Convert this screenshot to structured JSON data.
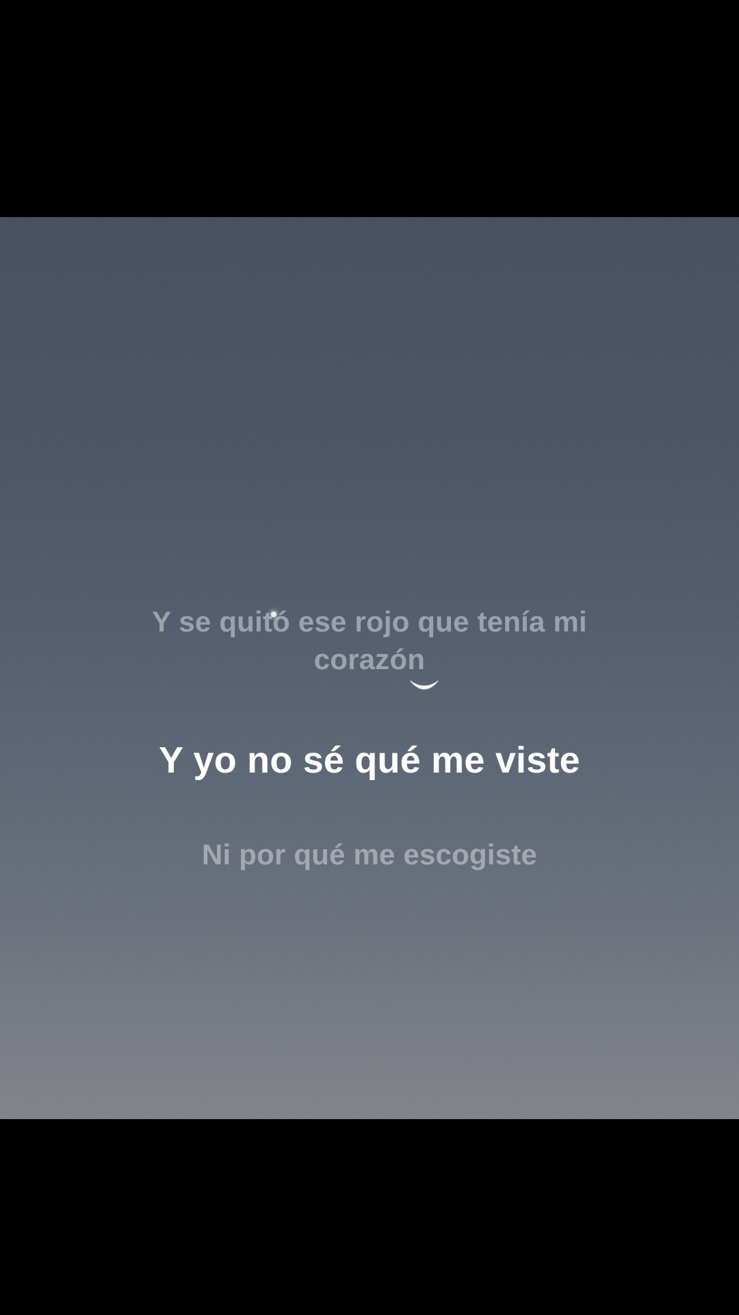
{
  "lyrics": {
    "previous_line_1": "Y se quitó ese rojo que tenía mi",
    "previous_line_2": "corazón",
    "current_line": "Y yo no sé qué me viste",
    "next_line": "Ni por qué me escogiste"
  },
  "icons": {
    "moon": "crescent-moon-icon",
    "star": "star-icon"
  },
  "colors": {
    "background": "#000000",
    "sky_top": "#3c4757",
    "sky_bottom": "#7c7f86",
    "current_lyric": "#ffffff",
    "dim_lyric": "#c8cbd2"
  }
}
